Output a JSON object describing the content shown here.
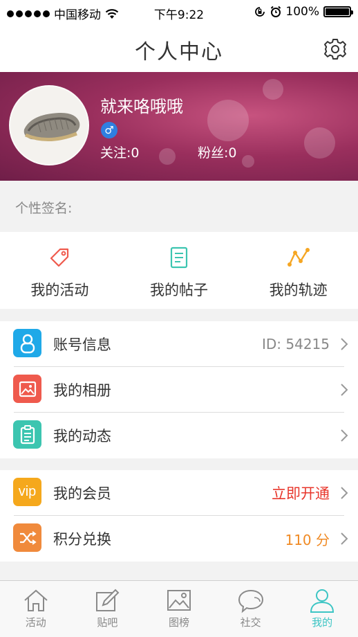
{
  "status_bar": {
    "carrier": "中国移动",
    "time": "下午9:22",
    "battery": "100%"
  },
  "header": {
    "title": "个人中心",
    "settings_icon": "gear-icon"
  },
  "profile": {
    "username": "就来咯哦哦",
    "gender_symbol": "♂",
    "following": "关注:0",
    "followers": "粉丝:0"
  },
  "signature": {
    "label": "个性签名:"
  },
  "quick_actions": [
    {
      "label": "我的活动",
      "icon": "tag-icon",
      "color": "#ef5a4d"
    },
    {
      "label": "我的帖子",
      "icon": "document-icon",
      "color": "#3cc5b0"
    },
    {
      "label": "我的轨迹",
      "icon": "track-icon",
      "color": "#f5a623"
    }
  ],
  "menu_group1": [
    {
      "label": "账号信息",
      "value": "ID:  54215",
      "icon": "user-icon",
      "color": "#1fa9e8"
    },
    {
      "label": "我的相册",
      "value": "",
      "icon": "photo-icon",
      "color": "#ef5a4d"
    },
    {
      "label": "我的动态",
      "value": "",
      "icon": "clipboard-icon",
      "color": "#3cc5b0"
    }
  ],
  "menu_group2": [
    {
      "label": "我的会员",
      "value": "立即开通",
      "value_color": "#e8372c",
      "icon": "vip-icon",
      "icon_text": "vip",
      "color": "#f5a81c"
    },
    {
      "label": "积分兑换",
      "value": "110 分",
      "value_color": "#f08a24",
      "icon": "shuffle-icon",
      "color": "#f08a3c"
    }
  ],
  "tab_bar": [
    {
      "label": "活动",
      "icon": "house-icon",
      "active": false
    },
    {
      "label": "贴吧",
      "icon": "edit-icon",
      "active": false
    },
    {
      "label": "图榜",
      "icon": "image-icon",
      "active": false
    },
    {
      "label": "社交",
      "icon": "chat-icon",
      "active": false
    },
    {
      "label": "我的",
      "icon": "person-icon",
      "active": true
    }
  ],
  "colors": {
    "accent": "#3cc5c4",
    "banner": "#9a2f5d"
  }
}
